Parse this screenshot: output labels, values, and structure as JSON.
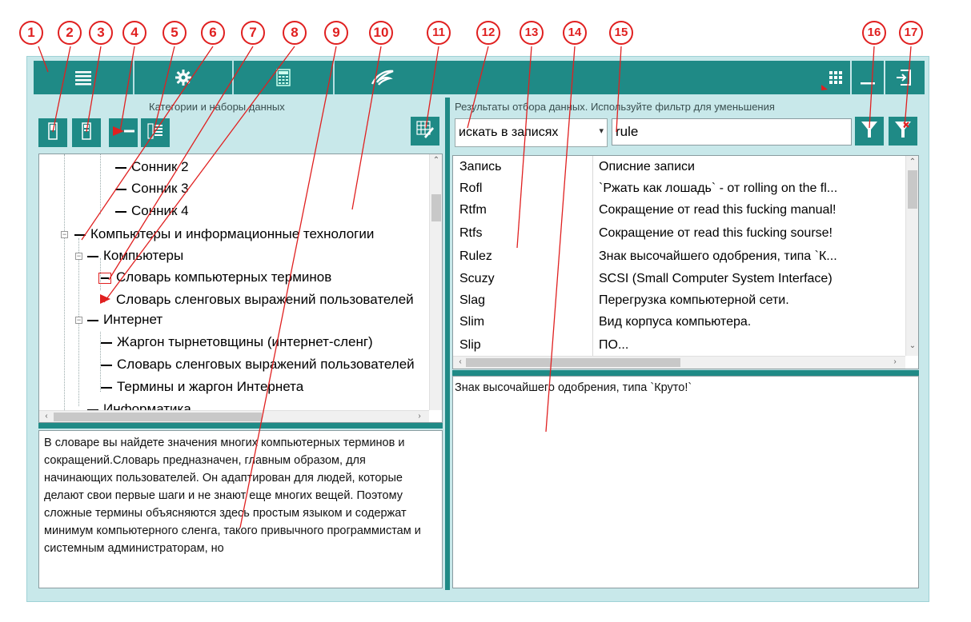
{
  "toolbar": {
    "buttons": [
      {
        "name": "menu-icon"
      },
      {
        "name": "settings-icon"
      },
      {
        "name": "calculator-icon"
      },
      {
        "name": "logo-icon"
      }
    ],
    "right_buttons": [
      {
        "name": "grid-view-icon"
      },
      {
        "name": "minimize-icon"
      },
      {
        "name": "exit-icon"
      }
    ],
    "accent": "#1f8a86",
    "background": "#c8e8ea"
  },
  "left_panel": {
    "caption": "Категории и наборы данных",
    "tree": {
      "items": [
        {
          "label": "Сонник 2"
        },
        {
          "label": "Сонник 3"
        },
        {
          "label": "Сонник 4"
        },
        {
          "label": "Компьютеры и информационные технологии"
        },
        {
          "label": "Компьютеры"
        },
        {
          "label": "Словарь компьютерных терминов"
        },
        {
          "label": "Словарь сленговых выражений пользователей"
        },
        {
          "label": "Интернет"
        },
        {
          "label": "Жаргон тырнетовщины (интернет-сленг)"
        },
        {
          "label": "Словарь сленговых выражений пользователей"
        },
        {
          "label": "Термины и жаргон Интернета"
        },
        {
          "label": "Информатика"
        }
      ]
    },
    "description": "В словаре вы найдете значения многих компьютерных терминов и сокращений.Словарь предназначен, главным образом, для начинающих пользователей. Он адаптирован для людей, которые делают свои первые шаги и не знают еще многих вещей. Поэтому сложные термины объясняются здесь простым языком и содержат минимум компьютерного сленга, такого привычного программистам и системным администраторам, но"
  },
  "right_panel": {
    "caption": "Результаты отбора данных. Используйте фильтр для уменьшения",
    "search_mode": "искать в записях",
    "search_value": "rule",
    "columns": [
      "Запись",
      "Описние записи"
    ],
    "rows": [
      {
        "key": "Rofl",
        "desc": "`Ржать как лошадь` - от rolling on the fl..."
      },
      {
        "key": "Rtfm",
        "desc": "Сокращение от read this fucking manual!"
      },
      {
        "key": "Rtfs",
        "desc": "Сокращение от read this fucking sourse!"
      },
      {
        "key": "Rulez",
        "desc": "Знак высочайшего одобрения, типа `К..."
      },
      {
        "key": "Scuzy",
        "desc": "SCSI (Small Computer System Interface)"
      },
      {
        "key": "Slag",
        "desc": "Перегрузка компьютерной сети."
      },
      {
        "key": "Slim",
        "desc": "Вид корпуса компьютера."
      },
      {
        "key": "Slip",
        "desc": "ПО..."
      }
    ],
    "detail": "Знак высочайшего одобрения, типа `Круто!`"
  },
  "callouts": [
    "1",
    "2",
    "3",
    "4",
    "5",
    "6",
    "7",
    "8",
    "9",
    "10",
    "11",
    "12",
    "13",
    "14",
    "15",
    "16",
    "17"
  ],
  "annotation_color": "#e02020"
}
